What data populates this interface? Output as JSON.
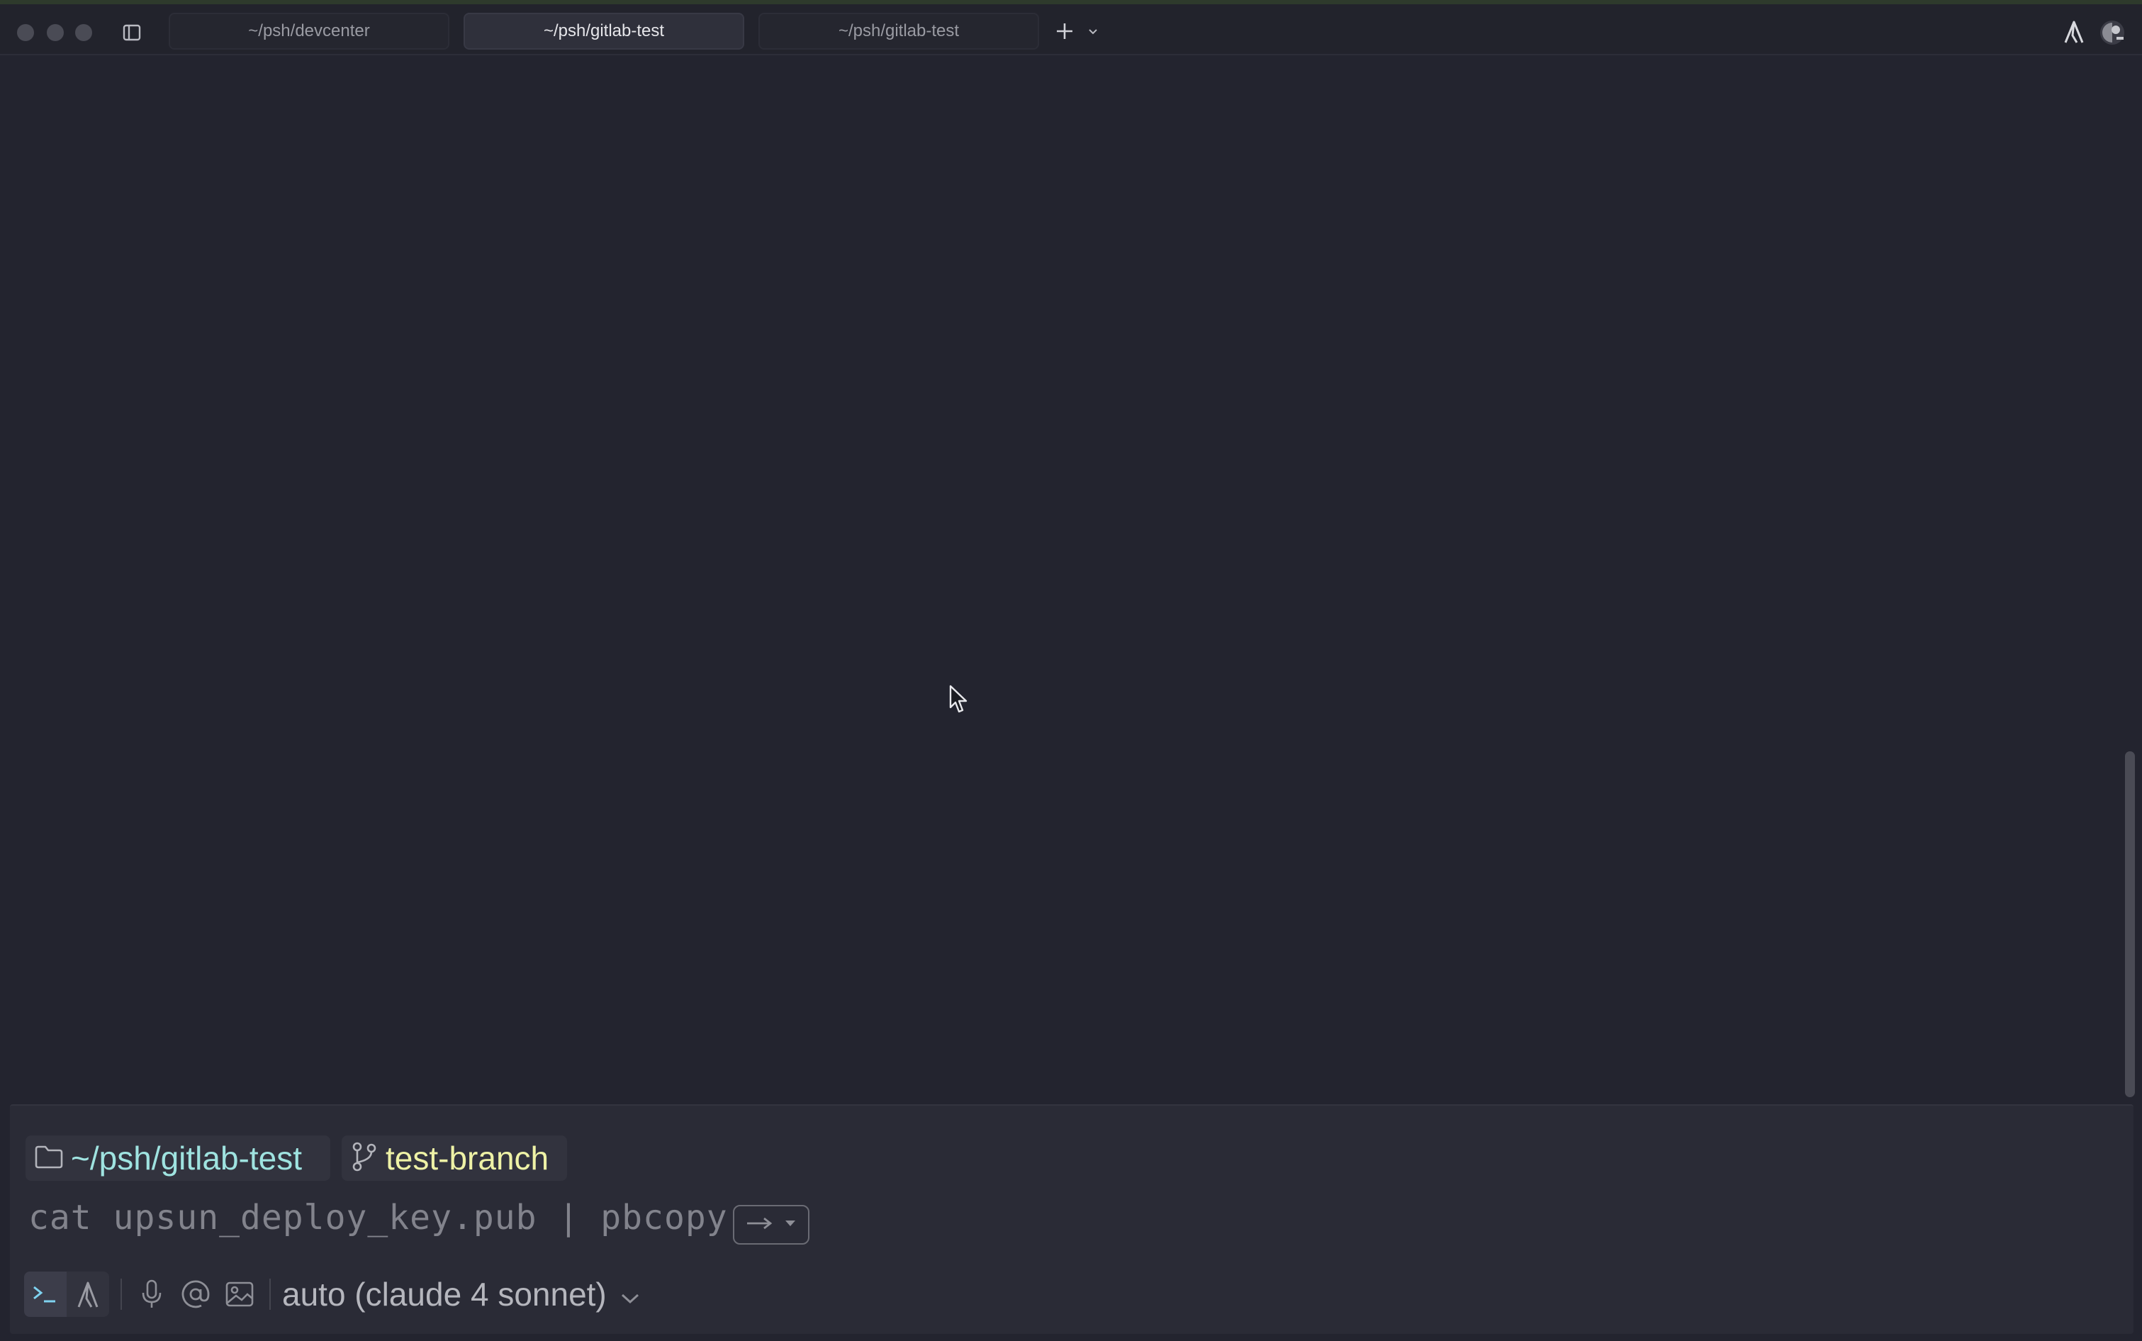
{
  "window": {
    "tabs": [
      {
        "label": "~/psh/devcenter",
        "active": false
      },
      {
        "label": "~/psh/gitlab-test",
        "active": true
      },
      {
        "label": "~/psh/gitlab-test",
        "active": false
      }
    ],
    "icons": {
      "sidebar_toggle": "sidebar-icon",
      "new_tab": "plus-icon",
      "tab_menu": "chevron-down-icon",
      "ai": "warp-ai-icon",
      "profile": "avatar"
    }
  },
  "input": {
    "directory": "~/psh/gitlab-test",
    "branch": "test-branch",
    "suggestion": "cat upsun_deploy_key.pub | pbcopy",
    "model_label": "auto (claude 4 sonnet)"
  },
  "colors": {
    "background": "#23242f",
    "directory_text": "#9fe3e0",
    "branch_text": "#eef2a6",
    "suggestion_text": "#82838c"
  }
}
